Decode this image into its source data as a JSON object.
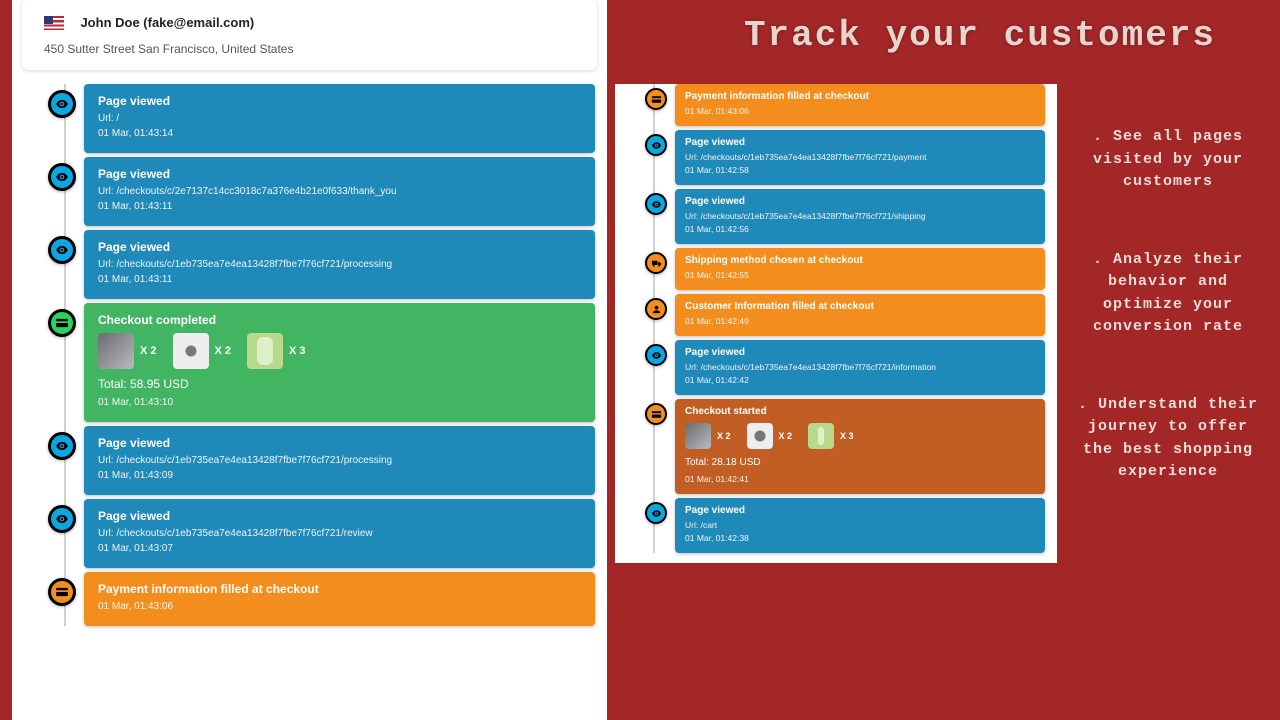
{
  "headline": "Track your customers",
  "bullets": [
    ". See all pages visited by your customers",
    ". Analyze their behavior and optimize your conversion rate",
    ". Understand their journey to offer the best shopping experience"
  ],
  "customer": {
    "name": "John Doe (fake@email.com)",
    "address": "450 Sutter Street San Francisco, United States"
  },
  "left_events": [
    {
      "type": "view",
      "icon": "eye",
      "title": "Page viewed",
      "url": "Url: /",
      "ts": "01 Mar, 01:43:14",
      "variant": "blue"
    },
    {
      "type": "view",
      "icon": "eye",
      "title": "Page viewed",
      "url": "Url: /checkouts/c/2e7137c14cc3018c7a376e4b21e0f633/thank_you",
      "ts": "01 Mar, 01:43:11",
      "variant": "blue"
    },
    {
      "type": "view",
      "icon": "eye",
      "title": "Page viewed",
      "url": "Url: /checkouts/c/1eb735ea7e4ea13428f7fbe7f76cf721/processing",
      "ts": "01 Mar, 01:43:11",
      "variant": "blue"
    },
    {
      "type": "checkout",
      "icon": "card",
      "title": "Checkout completed",
      "products": [
        {
          "img": "a",
          "qty": "X 2"
        },
        {
          "img": "b",
          "qty": "X 2"
        },
        {
          "img": "c",
          "qty": "X 3"
        }
      ],
      "total": "Total: 58.95 USD",
      "ts": "01 Mar, 01:43:10",
      "variant": "green"
    },
    {
      "type": "view",
      "icon": "eye",
      "title": "Page viewed",
      "url": "Url: /checkouts/c/1eb735ea7e4ea13428f7fbe7f76cf721/processing",
      "ts": "01 Mar, 01:43:09",
      "variant": "blue"
    },
    {
      "type": "view",
      "icon": "eye",
      "title": "Page viewed",
      "url": "Url: /checkouts/c/1eb735ea7e4ea13428f7fbe7f76cf721/review",
      "ts": "01 Mar, 01:43:07",
      "variant": "blue"
    },
    {
      "type": "info",
      "icon": "card",
      "title": "Payment information filled at checkout",
      "ts": "01 Mar, 01:43:06",
      "variant": "orange"
    }
  ],
  "right_events": [
    {
      "type": "info",
      "icon": "card",
      "title": "Payment information filled at checkout",
      "ts": "01 Mar, 01:43:06",
      "variant": "orange"
    },
    {
      "type": "view",
      "icon": "eye",
      "title": "Page viewed",
      "url": "Url: /checkouts/c/1eb735ea7e4ea13428f7fbe7f76cf721/payment",
      "ts": "01 Mar, 01:42:58",
      "variant": "blue"
    },
    {
      "type": "view",
      "icon": "eye",
      "title": "Page viewed",
      "url": "Url: /checkouts/c/1eb735ea7e4ea13428f7fbe7f76cf721/shipping",
      "ts": "01 Mar, 01:42:56",
      "variant": "blue"
    },
    {
      "type": "info",
      "icon": "truck",
      "title": "Shipping method chosen at checkout",
      "ts": "01 Mar, 01:42:55",
      "variant": "orange"
    },
    {
      "type": "info",
      "icon": "user",
      "title": "Customer Information filled at checkout",
      "ts": "01 Mar, 01:42:49",
      "variant": "orange"
    },
    {
      "type": "view",
      "icon": "eye",
      "title": "Page viewed",
      "url": "Url: /checkouts/c/1eb735ea7e4ea13428f7fbe7f76cf721/information",
      "ts": "01 Mar, 01:42:42",
      "variant": "blue"
    },
    {
      "type": "checkout",
      "icon": "card",
      "title": "Checkout started",
      "products": [
        {
          "img": "a",
          "qty": "X 2"
        },
        {
          "img": "b",
          "qty": "X 2"
        },
        {
          "img": "c",
          "qty": "X 3"
        }
      ],
      "total": "Total: 28.18 USD",
      "ts": "01 Mar, 01:42:41",
      "variant": "orange-d"
    },
    {
      "type": "view",
      "icon": "eye",
      "title": "Page viewed",
      "url": "Url: /cart",
      "ts": "01 Mar, 01:42:38",
      "variant": "blue"
    }
  ]
}
